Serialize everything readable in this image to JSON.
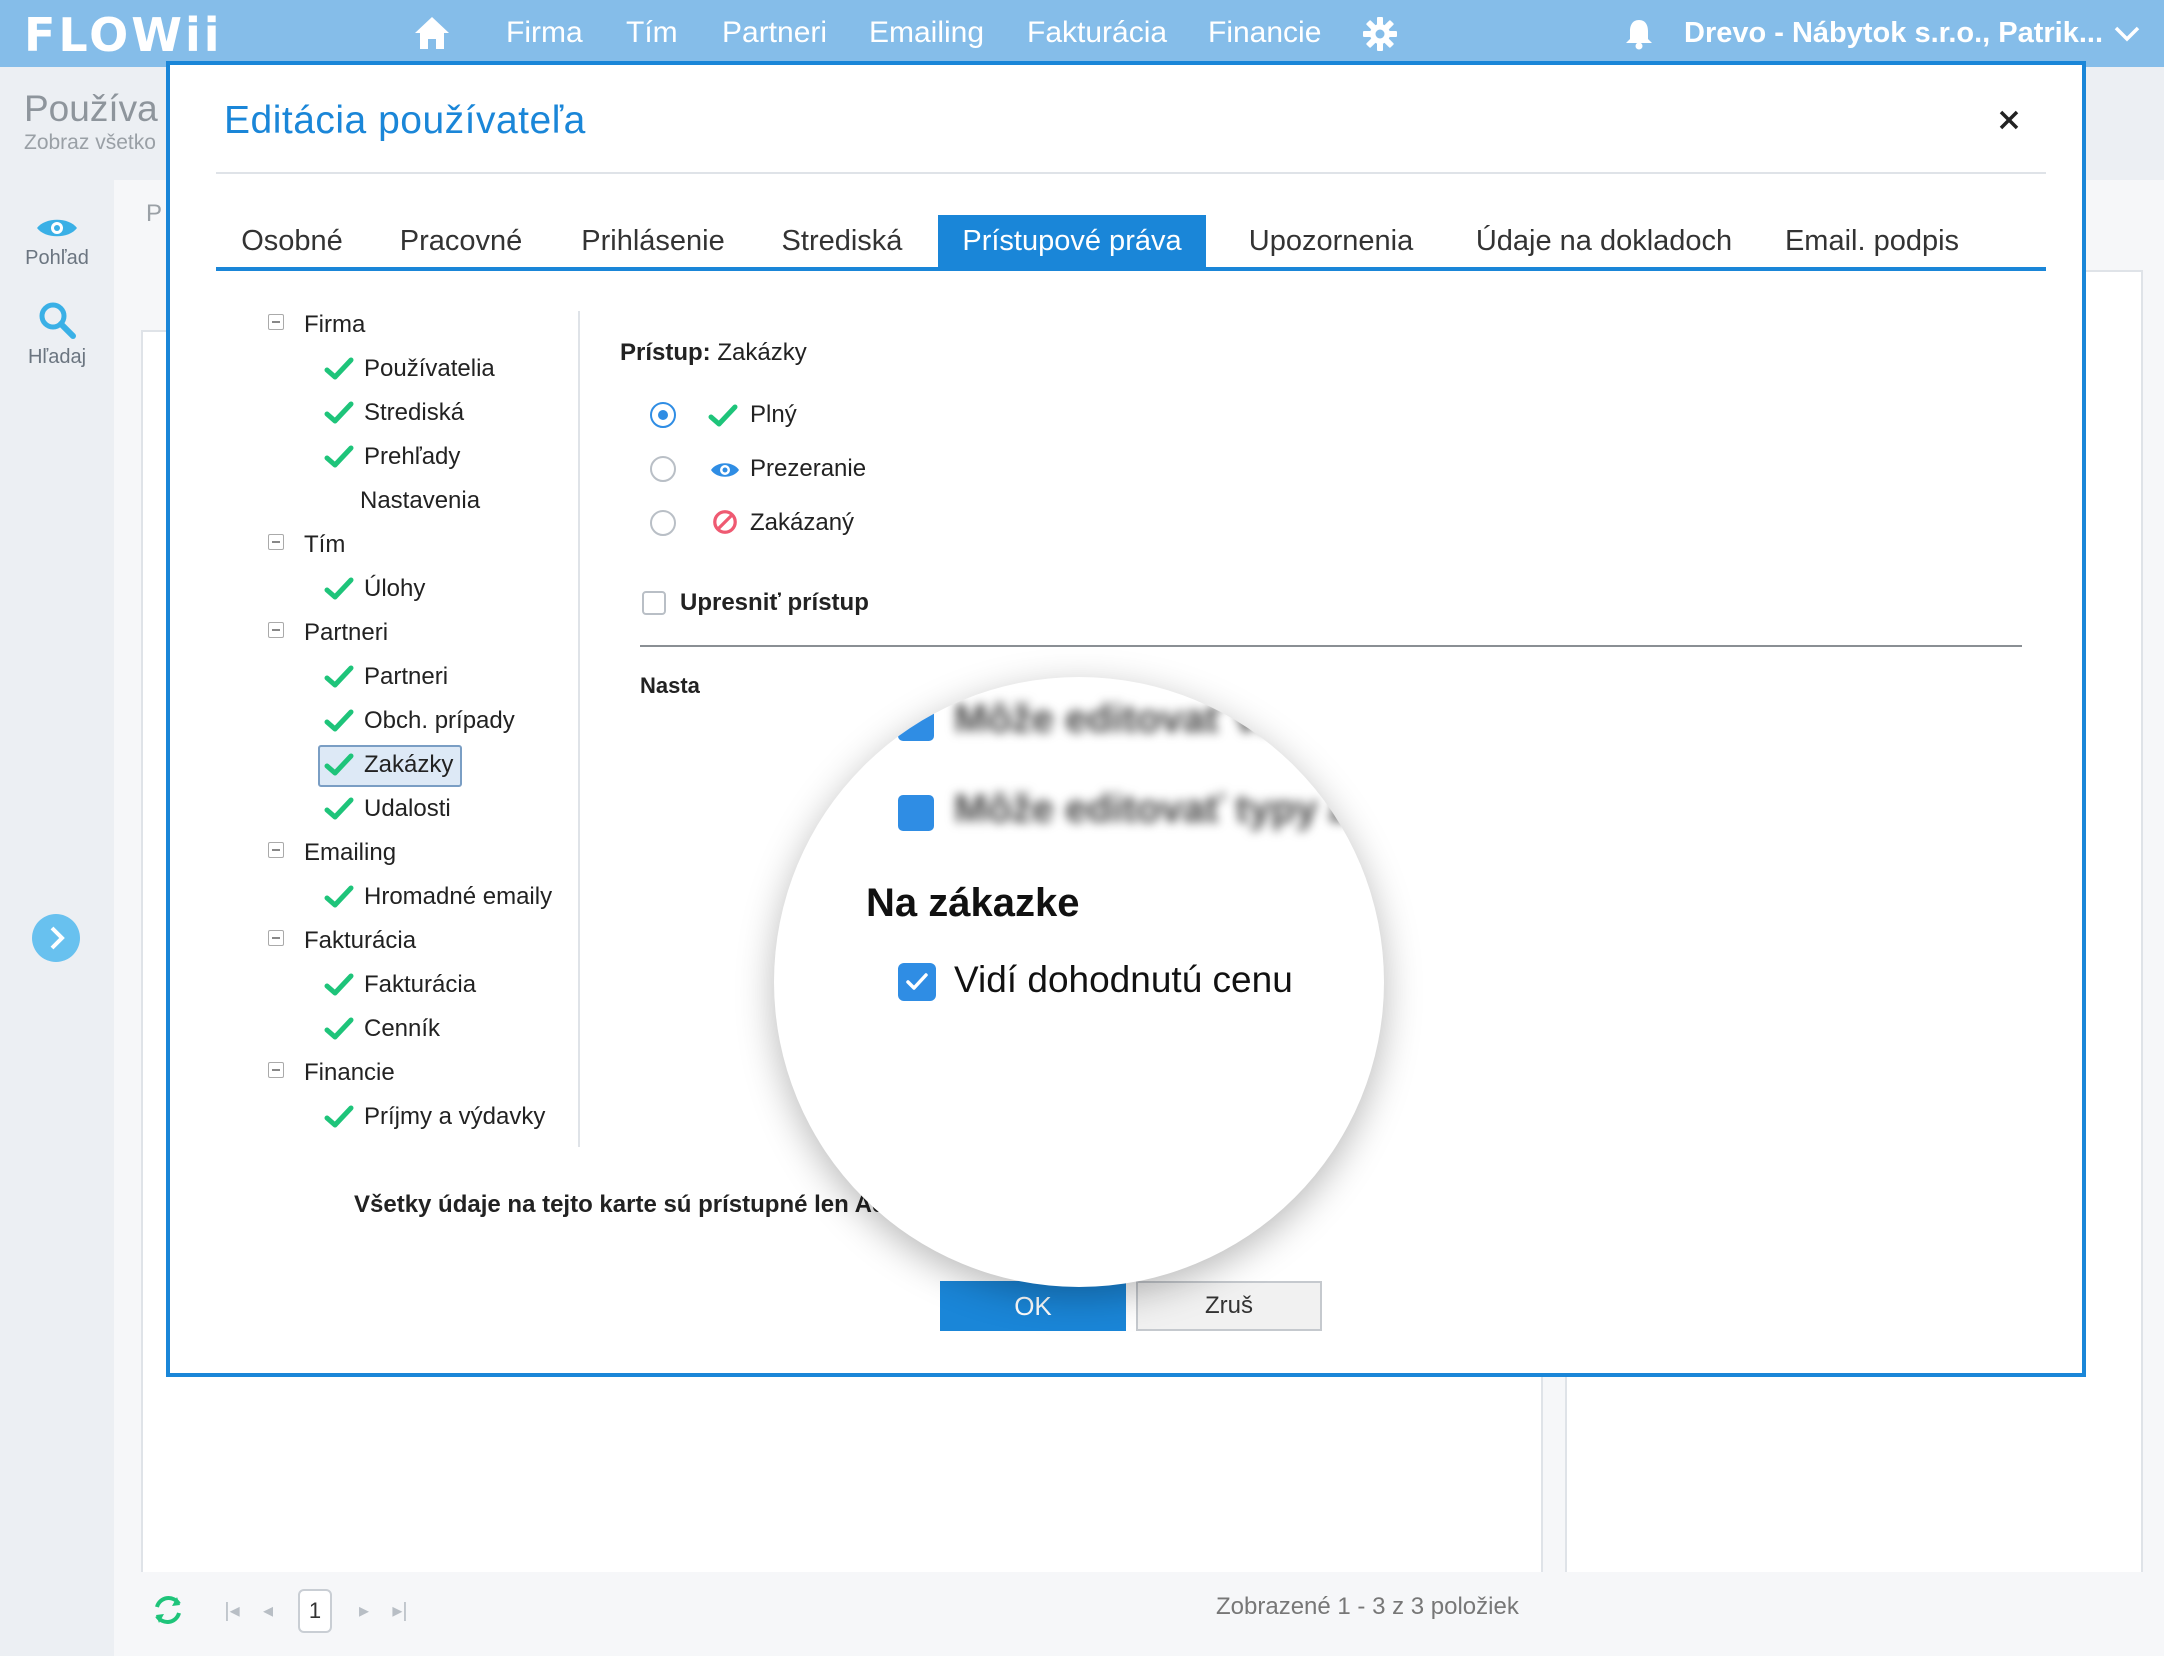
{
  "topbar": {
    "logo": "FLOWii",
    "nav": [
      "Firma",
      "Tím",
      "Partneri",
      "Emailing",
      "Fakturácia",
      "Financie"
    ],
    "company": "Drevo - Nábytok s.r.o., Patrik..."
  },
  "background": {
    "title": "Používa",
    "subtitle": "Zobraz všetko",
    "header_fragment": "P",
    "sidebar": [
      {
        "label": "Pohľad",
        "icon": "eye-icon"
      },
      {
        "label": "Hľadaj",
        "icon": "search-icon"
      }
    ],
    "pager": {
      "current": "1",
      "info": "Zobrazené 1 - 3 z 3 položiek"
    }
  },
  "dialog": {
    "title": "Editácia používateľa",
    "tabs": [
      "Osobné",
      "Pracovné",
      "Prihlásenie",
      "Strediská",
      "Prístupové práva",
      "Upozornenia",
      "Údaje na dokladoch",
      "Email. podpis"
    ],
    "active_tab": "Prístupové práva",
    "tree": [
      {
        "label": "Firma",
        "level": 0
      },
      {
        "label": "Používatelia",
        "level": 1,
        "checked": true
      },
      {
        "label": "Strediská",
        "level": 1,
        "checked": true
      },
      {
        "label": "Prehľady",
        "level": 1,
        "checked": true
      },
      {
        "label": "Nastavenia",
        "level": 1,
        "checked": false
      },
      {
        "label": "Tím",
        "level": 0
      },
      {
        "label": "Úlohy",
        "level": 1,
        "checked": true
      },
      {
        "label": "Partneri",
        "level": 0
      },
      {
        "label": "Partneri",
        "level": 1,
        "checked": true
      },
      {
        "label": "Obch. prípady",
        "level": 1,
        "checked": true
      },
      {
        "label": "Zakázky",
        "level": 1,
        "checked": true,
        "selected": true
      },
      {
        "label": "Udalosti",
        "level": 1,
        "checked": true
      },
      {
        "label": "Emailing",
        "level": 0
      },
      {
        "label": "Hromadné emaily",
        "level": 1,
        "checked": true
      },
      {
        "label": "Fakturácia",
        "level": 0
      },
      {
        "label": "Fakturácia",
        "level": 1,
        "checked": true
      },
      {
        "label": "Cenník",
        "level": 1,
        "checked": true
      },
      {
        "label": "Financie",
        "level": 0
      },
      {
        "label": "Príjmy a výdavky",
        "level": 1,
        "checked": true
      }
    ],
    "access": {
      "label": "Prístup:",
      "value": "Zakázky",
      "options": [
        {
          "label": "Plný",
          "icon": "check-icon",
          "selected": true
        },
        {
          "label": "Prezeranie",
          "icon": "eye-icon",
          "selected": false
        },
        {
          "label": "Zakázaný",
          "icon": "forbidden-icon",
          "selected": false
        }
      ]
    },
    "specify_label": "Upresniť prístup",
    "settings_label": "Nasta",
    "admin_note": "Všetky údaje na tejto karte sú prístupné len Admin",
    "ok": "OK",
    "cancel": "Zruš",
    "magnifier": {
      "blurred": [
        "Môže editovať vz",
        "Môže editovať typy a p"
      ],
      "section": "Na zákazke",
      "option": "Vidí dohodnutú cenu"
    }
  },
  "colors": {
    "accent": "#1a86d8",
    "topbar": "#85bde9",
    "check": "#1ec47a"
  }
}
